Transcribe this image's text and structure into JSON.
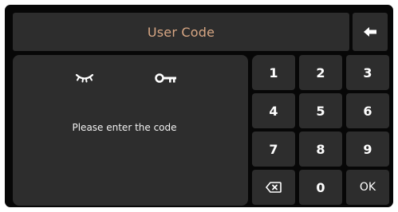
{
  "header": {
    "title": "User Code",
    "back_icon": "arrow-left-icon"
  },
  "code_panel": {
    "visibility_icon": "eye-closed-icon",
    "key_icon": "key-icon",
    "prompt": "Please enter the code"
  },
  "keypad": {
    "k1": "1",
    "k2": "2",
    "k3": "3",
    "k4": "4",
    "k5": "5",
    "k6": "6",
    "k7": "7",
    "k8": "8",
    "k9": "9",
    "backspace_icon": "backspace-icon",
    "k0": "0",
    "ok": "OK"
  },
  "colors": {
    "background": "#070707",
    "panel": "#2d2d2d",
    "title_text": "#d8a784",
    "text": "#ffffff"
  }
}
